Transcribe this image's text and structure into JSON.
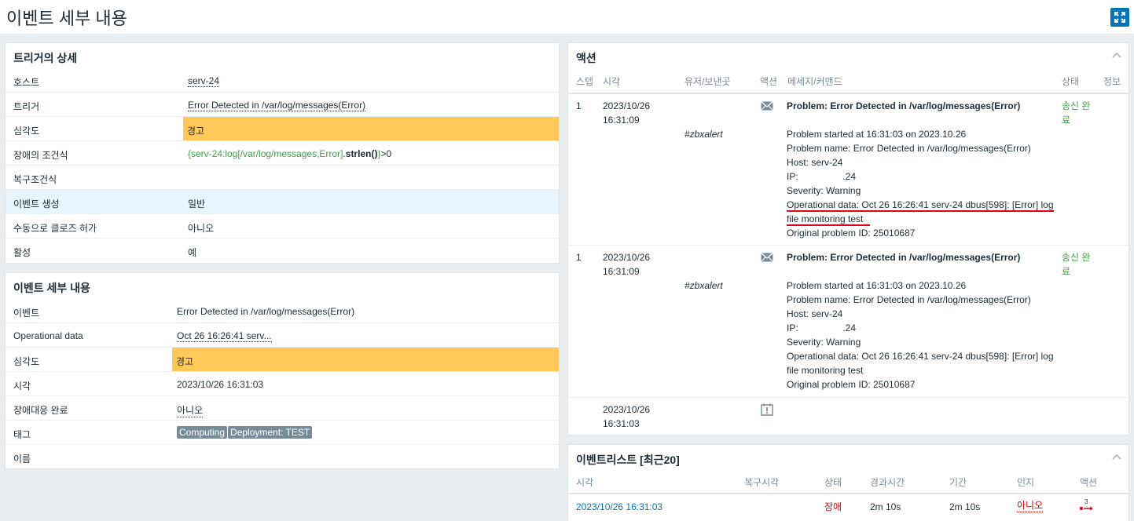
{
  "header": {
    "title": "이벤트 세부 내용"
  },
  "trigger_widget": {
    "title": "트리거의 상세",
    "rows": [
      {
        "label": "호스트",
        "value": "serv-24"
      },
      {
        "label": "트리거",
        "value": "Error Detected in /var/log/messages(Error)"
      },
      {
        "label": "심각도",
        "value": "경고"
      },
      {
        "label": "장애의 조건식",
        "expr_open": "{serv-24:log[/var/log/messages,Error]",
        "expr_dot": ".",
        "expr_fn": "strlen()",
        "expr_close": "}",
        "expr_cmp": ">0"
      },
      {
        "label": "복구조건식",
        "value": ""
      },
      {
        "label": "이벤트 생성",
        "value": "일반"
      },
      {
        "label": "수동으로 클로즈 허가",
        "value": "아니오"
      },
      {
        "label": "활성",
        "value": "예"
      }
    ]
  },
  "event_widget": {
    "title": "이벤트 세부 내용",
    "rows": [
      {
        "label": "이벤트",
        "value": "Error Detected in /var/log/messages(Error)"
      },
      {
        "label": "Operational data",
        "value": "Oct 26 16:26:41 serv..."
      },
      {
        "label": "심각도",
        "value": "경고"
      },
      {
        "label": "시각",
        "value": "2023/10/26 16:31:03"
      },
      {
        "label": "장애대응 완료",
        "value": "아니오"
      },
      {
        "label": "태그",
        "tags": [
          "Computing",
          "Deployment: TEST"
        ]
      },
      {
        "label": "이름",
        "value": ""
      }
    ]
  },
  "actions_widget": {
    "title": "액션",
    "columns": [
      "스텝",
      "시각",
      "유저/보낸곳",
      "액션",
      "메세지/커맨드",
      "상태",
      "정보"
    ],
    "rows": [
      {
        "step": "1",
        "date": "2023/10/26",
        "time": "16:31:09",
        "user": "#zbxalert",
        "icon": "envelope-icon",
        "subject": "Problem: Error Detected in /var/log/messages(Error)",
        "lines": [
          "Problem started at 16:31:03 on 2023.10.26",
          "Problem name: Error Detected in /var/log/messages(Error)",
          "Host: serv-24",
          "IP:                 .24",
          "Severity: Warning",
          "Operational data: Oct 26 16:26:41 serv-24 dbus[598]: [Error] log",
          "file monitoring test",
          "Original problem ID: 25010687"
        ],
        "status_1": "송신 완",
        "status_2": "료"
      },
      {
        "step": "1",
        "date": "2023/10/26",
        "time": "16:31:09",
        "user": "#zbxalert",
        "icon": "envelope-icon",
        "subject": "Problem: Error Detected in /var/log/messages(Error)",
        "lines": [
          "Problem started at 16:31:03 on 2023.10.26",
          "Problem name: Error Detected in /var/log/messages(Error)",
          "Host: serv-24",
          "IP:                 .24",
          "Severity: Warning",
          "Operational data: Oct 26 16:26:41 serv-24 dbus[598]: [Error] log",
          "file monitoring test",
          "Original problem ID: 25010687"
        ],
        "status_1": "송신 완",
        "status_2": "료"
      },
      {
        "step": "",
        "date": "2023/10/26",
        "time": "16:31:03",
        "icon": "problem-created-icon"
      }
    ]
  },
  "eventlist_widget": {
    "title": "이벤트리스트 [최근20]",
    "columns": [
      "시각",
      "복구시각",
      "상태",
      "경과시간",
      "기간",
      "인지",
      "액션"
    ],
    "rows": [
      {
        "time": "2023/10/26 16:31:03",
        "recovery": "",
        "status": "장애",
        "age": "2m 10s",
        "duration": "2m 10s",
        "ack": "아니오",
        "actions_count": "3"
      }
    ]
  },
  "colors": {
    "warning": "#ffc859",
    "accent": "#0275b8",
    "red": "#d40000",
    "green": "#429e47"
  }
}
